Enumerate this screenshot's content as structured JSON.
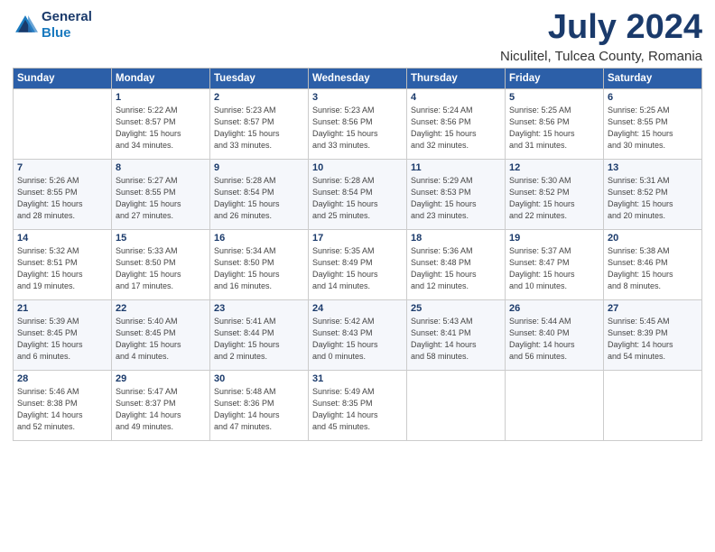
{
  "header": {
    "logo_line1": "General",
    "logo_line2": "Blue",
    "month_year": "July 2024",
    "location": "Niculitel, Tulcea County, Romania"
  },
  "days_of_week": [
    "Sunday",
    "Monday",
    "Tuesday",
    "Wednesday",
    "Thursday",
    "Friday",
    "Saturday"
  ],
  "weeks": [
    [
      {
        "day": "",
        "detail": ""
      },
      {
        "day": "1",
        "detail": "Sunrise: 5:22 AM\nSunset: 8:57 PM\nDaylight: 15 hours\nand 34 minutes."
      },
      {
        "day": "2",
        "detail": "Sunrise: 5:23 AM\nSunset: 8:57 PM\nDaylight: 15 hours\nand 33 minutes."
      },
      {
        "day": "3",
        "detail": "Sunrise: 5:23 AM\nSunset: 8:56 PM\nDaylight: 15 hours\nand 33 minutes."
      },
      {
        "day": "4",
        "detail": "Sunrise: 5:24 AM\nSunset: 8:56 PM\nDaylight: 15 hours\nand 32 minutes."
      },
      {
        "day": "5",
        "detail": "Sunrise: 5:25 AM\nSunset: 8:56 PM\nDaylight: 15 hours\nand 31 minutes."
      },
      {
        "day": "6",
        "detail": "Sunrise: 5:25 AM\nSunset: 8:55 PM\nDaylight: 15 hours\nand 30 minutes."
      }
    ],
    [
      {
        "day": "7",
        "detail": "Sunrise: 5:26 AM\nSunset: 8:55 PM\nDaylight: 15 hours\nand 28 minutes."
      },
      {
        "day": "8",
        "detail": "Sunrise: 5:27 AM\nSunset: 8:55 PM\nDaylight: 15 hours\nand 27 minutes."
      },
      {
        "day": "9",
        "detail": "Sunrise: 5:28 AM\nSunset: 8:54 PM\nDaylight: 15 hours\nand 26 minutes."
      },
      {
        "day": "10",
        "detail": "Sunrise: 5:28 AM\nSunset: 8:54 PM\nDaylight: 15 hours\nand 25 minutes."
      },
      {
        "day": "11",
        "detail": "Sunrise: 5:29 AM\nSunset: 8:53 PM\nDaylight: 15 hours\nand 23 minutes."
      },
      {
        "day": "12",
        "detail": "Sunrise: 5:30 AM\nSunset: 8:52 PM\nDaylight: 15 hours\nand 22 minutes."
      },
      {
        "day": "13",
        "detail": "Sunrise: 5:31 AM\nSunset: 8:52 PM\nDaylight: 15 hours\nand 20 minutes."
      }
    ],
    [
      {
        "day": "14",
        "detail": "Sunrise: 5:32 AM\nSunset: 8:51 PM\nDaylight: 15 hours\nand 19 minutes."
      },
      {
        "day": "15",
        "detail": "Sunrise: 5:33 AM\nSunset: 8:50 PM\nDaylight: 15 hours\nand 17 minutes."
      },
      {
        "day": "16",
        "detail": "Sunrise: 5:34 AM\nSunset: 8:50 PM\nDaylight: 15 hours\nand 16 minutes."
      },
      {
        "day": "17",
        "detail": "Sunrise: 5:35 AM\nSunset: 8:49 PM\nDaylight: 15 hours\nand 14 minutes."
      },
      {
        "day": "18",
        "detail": "Sunrise: 5:36 AM\nSunset: 8:48 PM\nDaylight: 15 hours\nand 12 minutes."
      },
      {
        "day": "19",
        "detail": "Sunrise: 5:37 AM\nSunset: 8:47 PM\nDaylight: 15 hours\nand 10 minutes."
      },
      {
        "day": "20",
        "detail": "Sunrise: 5:38 AM\nSunset: 8:46 PM\nDaylight: 15 hours\nand 8 minutes."
      }
    ],
    [
      {
        "day": "21",
        "detail": "Sunrise: 5:39 AM\nSunset: 8:45 PM\nDaylight: 15 hours\nand 6 minutes."
      },
      {
        "day": "22",
        "detail": "Sunrise: 5:40 AM\nSunset: 8:45 PM\nDaylight: 15 hours\nand 4 minutes."
      },
      {
        "day": "23",
        "detail": "Sunrise: 5:41 AM\nSunset: 8:44 PM\nDaylight: 15 hours\nand 2 minutes."
      },
      {
        "day": "24",
        "detail": "Sunrise: 5:42 AM\nSunset: 8:43 PM\nDaylight: 15 hours\nand 0 minutes."
      },
      {
        "day": "25",
        "detail": "Sunrise: 5:43 AM\nSunset: 8:41 PM\nDaylight: 14 hours\nand 58 minutes."
      },
      {
        "day": "26",
        "detail": "Sunrise: 5:44 AM\nSunset: 8:40 PM\nDaylight: 14 hours\nand 56 minutes."
      },
      {
        "day": "27",
        "detail": "Sunrise: 5:45 AM\nSunset: 8:39 PM\nDaylight: 14 hours\nand 54 minutes."
      }
    ],
    [
      {
        "day": "28",
        "detail": "Sunrise: 5:46 AM\nSunset: 8:38 PM\nDaylight: 14 hours\nand 52 minutes."
      },
      {
        "day": "29",
        "detail": "Sunrise: 5:47 AM\nSunset: 8:37 PM\nDaylight: 14 hours\nand 49 minutes."
      },
      {
        "day": "30",
        "detail": "Sunrise: 5:48 AM\nSunset: 8:36 PM\nDaylight: 14 hours\nand 47 minutes."
      },
      {
        "day": "31",
        "detail": "Sunrise: 5:49 AM\nSunset: 8:35 PM\nDaylight: 14 hours\nand 45 minutes."
      },
      {
        "day": "",
        "detail": ""
      },
      {
        "day": "",
        "detail": ""
      },
      {
        "day": "",
        "detail": ""
      }
    ]
  ]
}
